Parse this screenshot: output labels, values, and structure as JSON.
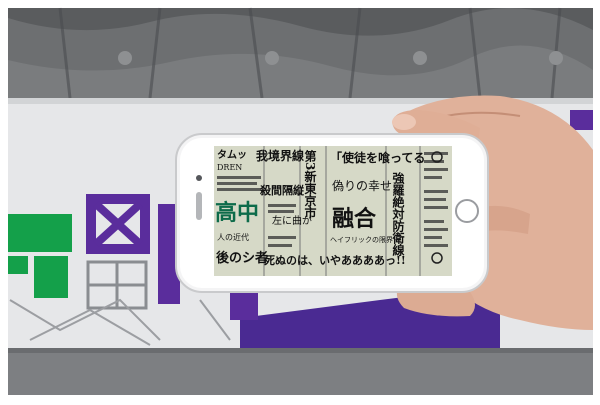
{
  "phone_screen": {
    "text_lines": [
      "タムッ",
      "DREN",
      "高中",
      "人の近代",
      "後のシ者",
      "我境界線",
      "殺間隔縦",
      "第3新東京市",
      "左に曲が",
      "「使徒を喰ってる",
      "偽りの幸せ",
      "融合",
      "ヘイフリックの限界",
      "強羅絶対防衛線",
      "死ぬのは、いやああああっ!!"
    ]
  }
}
